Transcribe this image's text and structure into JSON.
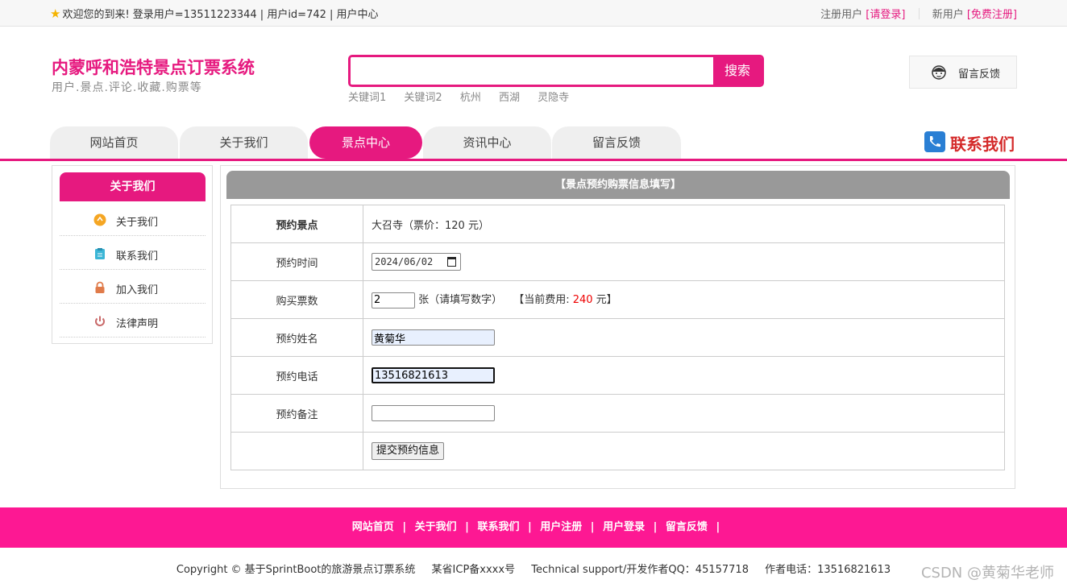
{
  "topbar": {
    "welcome": "欢迎您的到来!  登录用户=13511223344 | 用户id=742 | 用户中心",
    "register_label": "注册用户",
    "login_link": "[请登录]",
    "new_user_label": "新用户",
    "register_link": "[免费注册]"
  },
  "header": {
    "title": "内蒙呼和浩特景点订票系统",
    "subtitle": "用户.景点.评论.收藏.购票等",
    "search_button": "搜索",
    "search_value": "",
    "keywords": [
      "关键词1",
      "关键词2",
      "杭州",
      "西湖",
      "灵隐寺"
    ],
    "feedback": "留言反馈"
  },
  "nav": {
    "items": [
      "网站首页",
      "关于我们",
      "景点中心",
      "资讯中心",
      "留言反馈"
    ],
    "active_index": 2,
    "contact": "联系我们"
  },
  "sidebar": {
    "title": "关于我们",
    "items": [
      "关于我们",
      "联系我们",
      "加入我们",
      "法律声明"
    ]
  },
  "panel": {
    "title": "【景点预约购票信息填写】",
    "rows": {
      "spot_label": "预约景点",
      "spot_value": "大召寺（票价：120 元）",
      "time_label": "预约时间",
      "time_value": "2024/06/02",
      "count_label": "购买票数",
      "count_value": "2",
      "count_hint": "张（请填写数字）",
      "fee_prefix": "【当前费用:",
      "fee_value": "240",
      "fee_suffix": "元】",
      "name_label": "预约姓名",
      "name_value": "黄菊华",
      "phone_label": "预约电话",
      "phone_value": "13516821613",
      "note_label": "预约备注",
      "note_value": "",
      "submit": "提交预约信息"
    }
  },
  "footer": {
    "links": [
      "网站首页",
      "关于我们",
      "联系我们",
      "用户注册",
      "用户登录",
      "留言反馈"
    ],
    "copyright": "Copyright © 基于SprintBoot的旅游景点订票系统",
    "icp": "某省ICP备xxxx号",
    "support": "Technical support/开发作者QQ：45157718",
    "phone": "作者电话：13516821613"
  },
  "watermark": "CSDN @黄菊华老师",
  "colors": {
    "accent": "#e6197f",
    "footer": "#fd1893",
    "panel_head": "#999999",
    "fee": "#ee0000"
  }
}
